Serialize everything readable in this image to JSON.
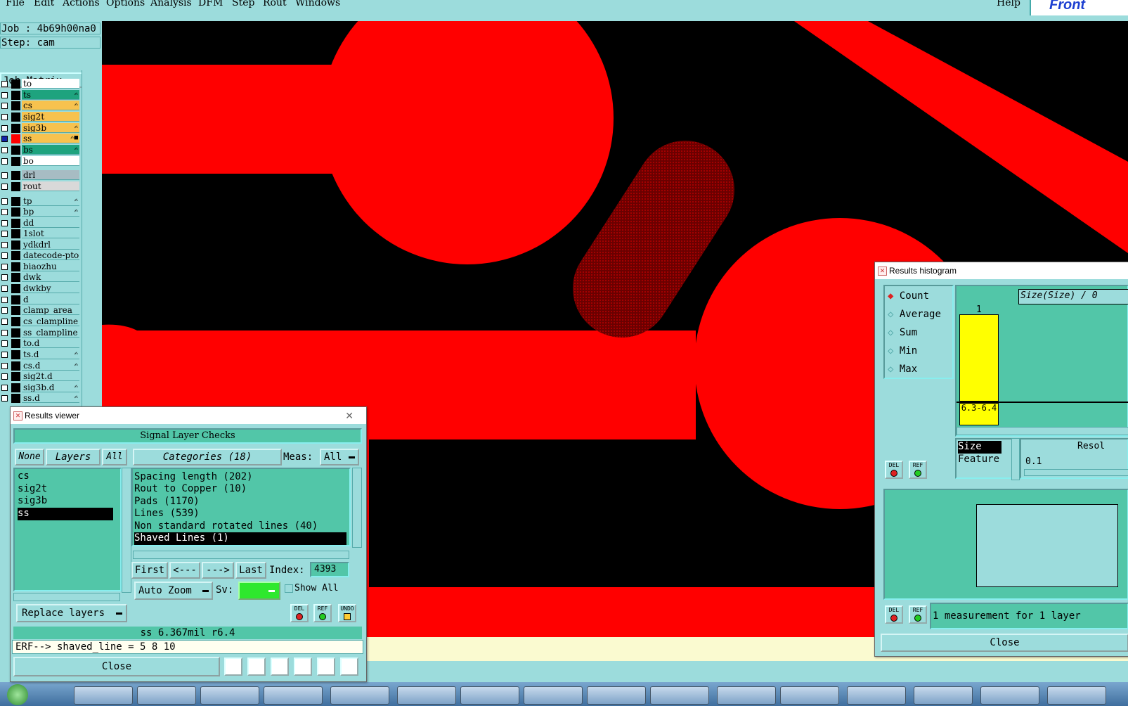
{
  "menubar": {
    "items": [
      "File",
      "Edit",
      "Actions",
      "Options",
      "Analysis",
      "DFM",
      "Step",
      "Rout",
      "Windows"
    ],
    "help": "Help",
    "brand": "Front"
  },
  "job": {
    "label": "Job : 4b69h00na0",
    "step": "Step: cam",
    "matrix": "Job Matrix ..."
  },
  "layers": [
    {
      "name": "to",
      "color": "#ffffff",
      "mark": ""
    },
    {
      "name": "ts",
      "color": "#1ea37e",
      "mark": "✍"
    },
    {
      "name": "cs",
      "color": "#f7c24e",
      "mark": "✍"
    },
    {
      "name": "sig2t",
      "color": "#f7c24e",
      "mark": ""
    },
    {
      "name": "sig3b",
      "color": "#f7c24e",
      "mark": "✍"
    },
    {
      "name": "ss",
      "color": "#f7c24e",
      "mark": "✍■",
      "active": true
    },
    {
      "name": "bs",
      "color": "#1ea37e",
      "mark": "✍"
    },
    {
      "name": "bo",
      "color": "#ffffff",
      "mark": ""
    },
    {
      "name": "drl",
      "color": "#a7bcc3",
      "mark": ""
    },
    {
      "name": "rout",
      "color": "#d9d9d9",
      "mark": ""
    },
    {
      "name": "tp",
      "color": "#9cdcdc",
      "mark": "✍"
    },
    {
      "name": "bp",
      "color": "#9cdcdc",
      "mark": "✍"
    },
    {
      "name": "dd",
      "color": "#9cdcdc",
      "mark": ""
    },
    {
      "name": "1slot",
      "color": "#9cdcdc",
      "mark": ""
    },
    {
      "name": "ydkdrl",
      "color": "#9cdcdc",
      "mark": ""
    },
    {
      "name": "datecode-pto",
      "color": "#9cdcdc",
      "mark": ""
    },
    {
      "name": "biaozhu",
      "color": "#9cdcdc",
      "mark": ""
    },
    {
      "name": "dwk",
      "color": "#9cdcdc",
      "mark": ""
    },
    {
      "name": "dwkby",
      "color": "#9cdcdc",
      "mark": ""
    },
    {
      "name": "d",
      "color": "#9cdcdc",
      "mark": ""
    },
    {
      "name": "clamp_area",
      "color": "#9cdcdc",
      "mark": ""
    },
    {
      "name": "cs_clampline",
      "color": "#9cdcdc",
      "mark": ""
    },
    {
      "name": "ss_clampline",
      "color": "#9cdcdc",
      "mark": ""
    },
    {
      "name": "to.d",
      "color": "#9cdcdc",
      "mark": ""
    },
    {
      "name": "ts.d",
      "color": "#9cdcdc",
      "mark": "✍"
    },
    {
      "name": "cs.d",
      "color": "#9cdcdc",
      "mark": "✍"
    },
    {
      "name": "sig2t.d",
      "color": "#9cdcdc",
      "mark": ""
    },
    {
      "name": "sig3b.d",
      "color": "#9cdcdc",
      "mark": "✍"
    },
    {
      "name": "ss.d",
      "color": "#9cdcdc",
      "mark": "✍"
    }
  ],
  "results_viewer": {
    "title": "Results viewer",
    "header": "Signal Layer Checks",
    "none": "None",
    "layers_btn": "Layers",
    "all": "All",
    "layer_list": [
      "cs",
      "sig2t",
      "sig3b",
      "ss"
    ],
    "selected_layer": "ss",
    "categories_btn": "Categories (18)",
    "meas_label": "Meas:",
    "meas_value": "All",
    "categories": [
      "Spacing length (202)",
      "Rout to Copper (10)",
      "Pads (1170)",
      "Lines (539)",
      "Non standard rotated lines (40)",
      "Shaved Lines (1)"
    ],
    "selected_category": "Shaved Lines (1)",
    "first": "First",
    "prev": "<---",
    "next": "--->",
    "last": "Last",
    "index_label": "Index:",
    "index_value": "4393",
    "auto_zoom": "Auto Zoom",
    "sv_label": "Sv:",
    "show_all": "Show All",
    "replace_layers": "Replace layers",
    "del": "DEL",
    "ref": "REF",
    "undo": "UNDO",
    "status": "ss 6.367mil  r6.4",
    "erf": "ERF--> shaved_line = 5 8 10",
    "close": "Close"
  },
  "histogram": {
    "title": "Results histogram",
    "modes": [
      "Count",
      "Average",
      "Sum",
      "Min",
      "Max"
    ],
    "selected_mode": "Count",
    "size_title": "Size(Size) / 0",
    "bar_count": "1",
    "bar_label": "6.3-6.4",
    "bar_color": "#ffff00",
    "attr_list": [
      "Size",
      "Feature"
    ],
    "selected_attr": "Size",
    "resolution_label": "Resol",
    "resolution_value": "0.1",
    "del": "DEL",
    "ref": "REF",
    "summary": "1 measurement for 1 layer",
    "close": "Close"
  },
  "colors": {
    "copper": "#ff0000",
    "background": "#000000",
    "panel": "#9cdcdc",
    "dialog": "#52c6a8"
  }
}
